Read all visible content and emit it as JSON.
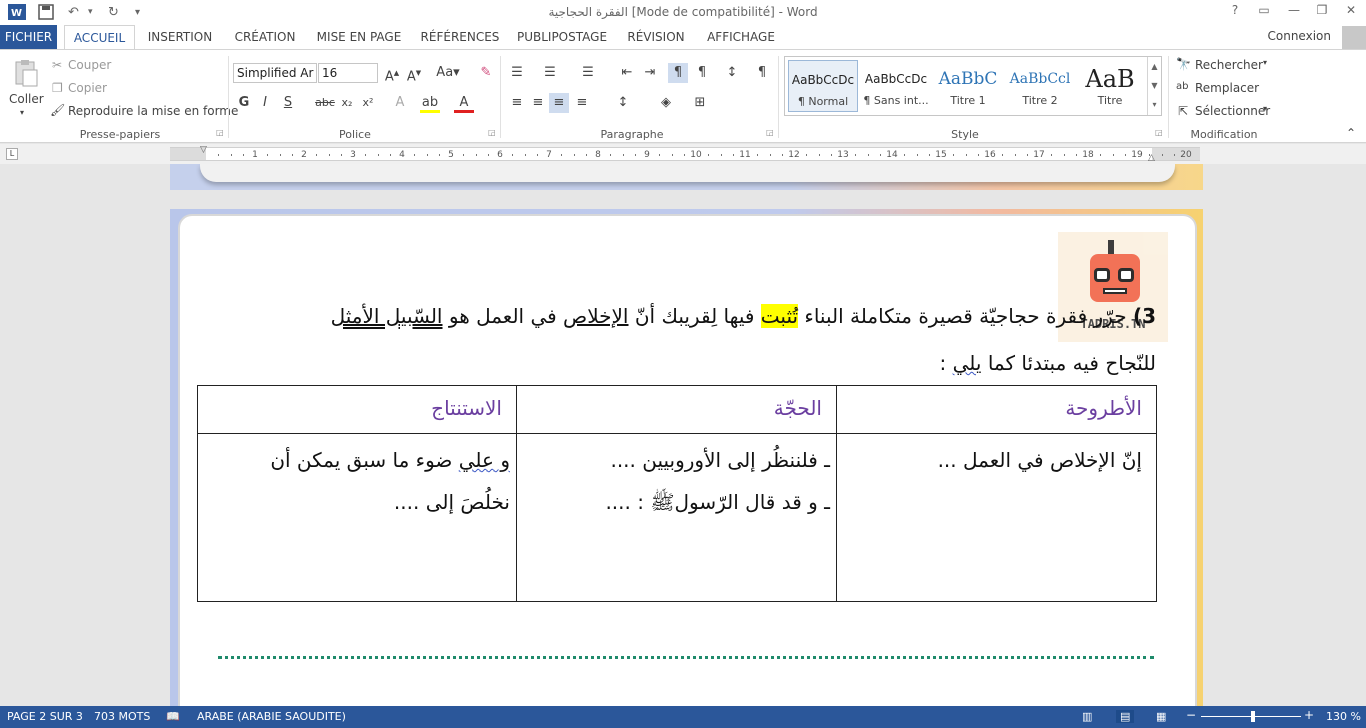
{
  "titlebar": {
    "title": "الفقرة الحجاجية [Mode de compatibilité] - Word",
    "app_icon": "word-icon",
    "help": "?",
    "minimize": "—",
    "restore": "❐",
    "close": "✕"
  },
  "tabs": [
    "FICHIER",
    "ACCUEIL",
    "INSERTION",
    "CRÉATION",
    "MISE EN PAGE",
    "RÉFÉRENCES",
    "PUBLIPOSTAGE",
    "RÉVISION",
    "AFFICHAGE"
  ],
  "connexion": "Connexion",
  "ribbon": {
    "clipboard": {
      "label": "Presse-papiers",
      "paste": "Coller",
      "cut": "Couper",
      "copy": "Copier",
      "format_painter": "Reproduire la mise en forme"
    },
    "font": {
      "label": "Police",
      "family": "Simplified Ar",
      "size": "16"
    },
    "paragraph": {
      "label": "Paragraphe"
    },
    "styles": {
      "label": "Style",
      "items": [
        {
          "preview": "AaBbCcDc",
          "name": "¶ Normal"
        },
        {
          "preview": "AaBbCcDc",
          "name": "¶ Sans int..."
        },
        {
          "preview": "AaBbC",
          "name": "Titre 1"
        },
        {
          "preview": "AaBbCcl",
          "name": "Titre 2"
        },
        {
          "preview": "AaB",
          "name": "Titre"
        }
      ]
    },
    "editing": {
      "label": "Modification",
      "find": "Rechercher",
      "replace": "Remplacer",
      "select": "Sélectionner"
    }
  },
  "ruler": {
    "ticks": [
      "1",
      "2",
      "3",
      "4",
      "5",
      "6",
      "7",
      "8",
      "9",
      "10",
      "11",
      "12",
      "13",
      "14",
      "15",
      "16",
      "17",
      "18",
      "19",
      "20"
    ]
  },
  "document": {
    "logo_text": "TADRIS.TN",
    "question_number": "3)",
    "question_line1_part1": "حرّر فقرة حجاجيّة قصيرة متكاملة البناء ",
    "question_line1_highlight": "تُثبت",
    "question_line1_part2": " فيها لِقريبك أنّ ",
    "question_line1_ul1": "الإخلاص",
    "question_line1_part3": " في العمل هو ",
    "question_line1_ul2": "السّبيل الأمثل",
    "question_line2_part1": "للنّجاح فيه مبتدئا كما ",
    "question_line2_ul": "يلي",
    "question_line2_part2": " :",
    "table": {
      "headers": [
        "الأطروحة",
        "الحجّة",
        "الاستنتاج"
      ],
      "col1_line1": "إنّ الإخلاص في العمل ...",
      "col2_line1": "ـ فلننظُر إلى الأوروبيين ....",
      "col2_line2": "ـ و قد قال الرّسولﷺ : ....",
      "col3_line1_ul": "و علي",
      "col3_line1_rest": " ضوء ما سبق يمكن أن",
      "col3_line2": "نخلُصَ إلى ...."
    }
  },
  "status": {
    "page": "PAGE 2 SUR 3",
    "words": "703 MOTS",
    "language": "ARABE (ARABIE SAOUDITE)",
    "zoom": "130 %",
    "zoom_level": 0.5
  },
  "colors": {
    "accent": "#2b579a",
    "highlight": "#ffff00",
    "header_text": "#6b3fa0",
    "dotted_line": "#1f8a6b"
  }
}
